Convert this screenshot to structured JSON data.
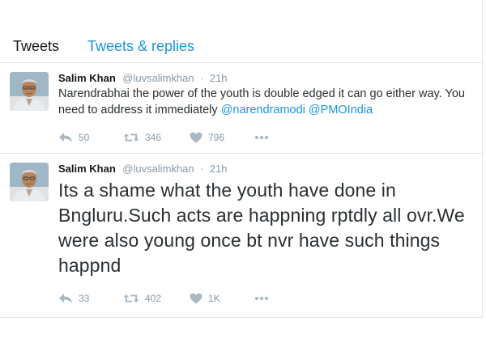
{
  "tabs": {
    "tweets": "Tweets",
    "tweets_replies": "Tweets & replies"
  },
  "tweets": [
    {
      "name": "Salim Khan",
      "handle": "@luvsalimkhan",
      "separator": "·",
      "time": "21h",
      "text": "Narendrabhai the power of the youth is double edged it can go either way. You need to address it immediately",
      "mentions": [
        "@narendramodi",
        "@PMOIndia"
      ],
      "replies": "50",
      "retweets": "346",
      "likes": "796"
    },
    {
      "name": "Salim Khan",
      "handle": "@luvsalimkhan",
      "separator": "·",
      "time": "21h",
      "text": "Its a shame what the youth have done in Bngluru.Such acts are happning rptdly all ovr.We were also young once bt nvr have such things happnd",
      "replies": "33",
      "retweets": "402",
      "likes": "1K"
    }
  ],
  "icons": {
    "reply": "reply-icon",
    "retweet": "retweet-icon",
    "like": "heart-icon",
    "more": "more-icon"
  },
  "colors": {
    "link": "#1b95e0",
    "muted": "#8899a6",
    "icon": "#aab8c2",
    "border": "#e1e8ed"
  }
}
